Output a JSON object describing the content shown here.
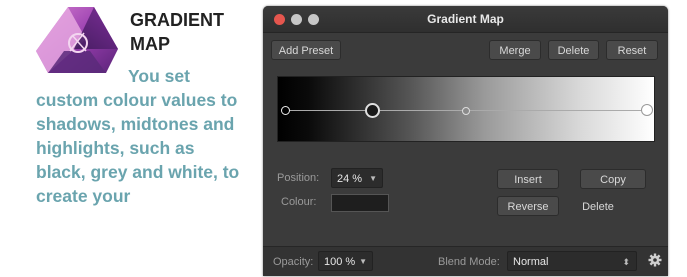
{
  "article": {
    "title": "GRADIENT MAP",
    "body": "You set custom colour values to shadows, midtones and highlights, such as black, grey and white, to create your"
  },
  "window": {
    "title": "Gradient Map",
    "traffic_lights": [
      "close",
      "minimize",
      "maximize"
    ]
  },
  "toolbar": {
    "add_preset": "Add Preset",
    "merge": "Merge",
    "delete": "Delete",
    "reset": "Reset"
  },
  "gradient": {
    "stops": [
      "black",
      "black",
      "grey",
      "white"
    ]
  },
  "stop_editor": {
    "position_label": "Position:",
    "position_value": "24 %",
    "colour_label": "Colour:",
    "insert": "Insert",
    "copy": "Copy",
    "reverse": "Reverse",
    "delete": "Delete"
  },
  "footer": {
    "opacity_label": "Opacity:",
    "opacity_value": "100 %",
    "blend_mode_label": "Blend Mode:",
    "blend_mode_value": "Normal",
    "settings_icon": "gear-icon"
  },
  "colors": {
    "accent_text": "#6aa4ae",
    "dialog_bg": "#3b3b3b",
    "close_button": "#e5564e"
  }
}
